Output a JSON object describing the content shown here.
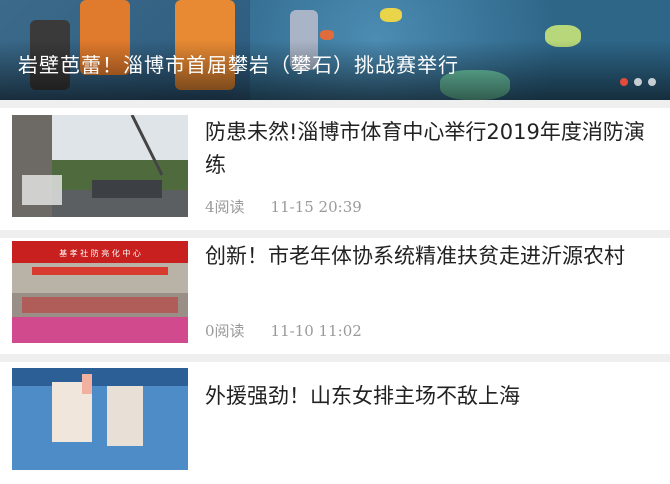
{
  "banner": {
    "title": "岩壁芭蕾！淄博市首届攀岩（攀石）挑战赛举行",
    "slide_count": 3,
    "active_slide": 1
  },
  "news": [
    {
      "title": "防患未然!淄博市体育中心举行2019年度消防演练",
      "reads": "4阅读",
      "time": "11-15 20:39"
    },
    {
      "title": "创新！市老年体协系统精准扶贫走进沂源农村",
      "reads": "0阅读",
      "time": "11-10 11:02"
    },
    {
      "title": "外援强劲！山东女排主场不敌上海",
      "reads": "",
      "time": ""
    }
  ],
  "thumb_captions": {
    "item2_banner": "基 孝 社 防 亮 化 中 心"
  },
  "colors": {
    "active_dot": "#e34b3c",
    "meta_text": "#9a9a9a",
    "title_text": "#222222"
  }
}
